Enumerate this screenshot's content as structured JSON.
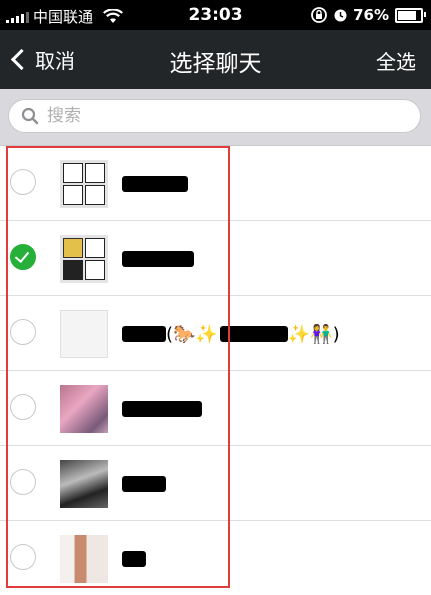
{
  "status_bar": {
    "carrier": "中国联通",
    "time": "23:03",
    "battery_percent": "76%",
    "battery_level": 0.76,
    "signal_icon": "signal-bars-icon",
    "wifi_icon": "wifi-icon"
  },
  "nav": {
    "cancel_label": "取消",
    "title": "选择聊天",
    "select_all_label": "全选"
  },
  "search": {
    "placeholder": "搜索"
  },
  "chats": [
    {
      "selected": false,
      "avatar": "group-avatar",
      "name_visible": ""
    },
    {
      "selected": true,
      "avatar": "group-avatar",
      "name_visible": ""
    },
    {
      "selected": false,
      "avatar": "photo-avatar",
      "name_visible": "(🐎✨",
      "name_visible_2": "✨👫)"
    },
    {
      "selected": false,
      "avatar": "photo-avatar",
      "name_visible": ""
    },
    {
      "selected": false,
      "avatar": "photo-avatar",
      "name_visible": ""
    },
    {
      "selected": false,
      "avatar": "photo-avatar",
      "name_visible": ""
    }
  ],
  "colors": {
    "nav_bg": "#232628",
    "check_green": "#26b03a",
    "annotation_red": "#e23b3b"
  }
}
